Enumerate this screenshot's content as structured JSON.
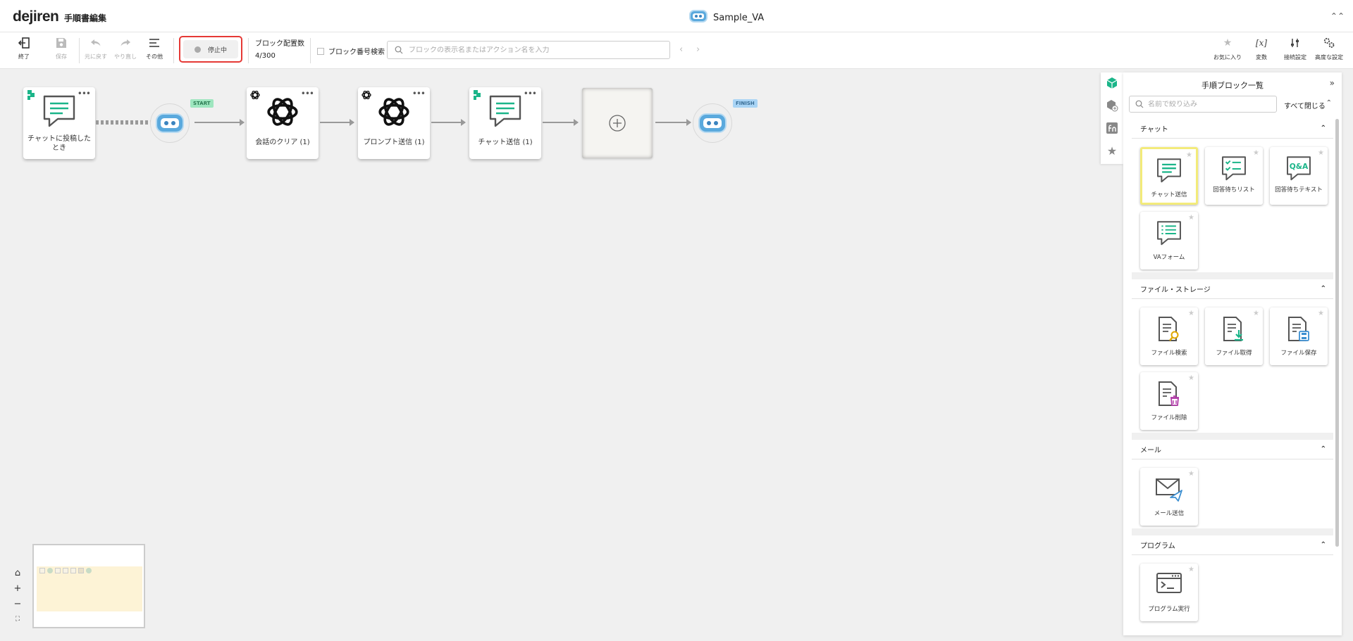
{
  "header": {
    "logo": "dejiren",
    "title": "手順書編集",
    "workflow_name": "Sample_VA"
  },
  "toolbar": {
    "exit_label": "終了",
    "save_label": "保存",
    "undo_label": "元に戻す",
    "redo_label": "やり直し",
    "other_label": "その他",
    "status_label": "停止中",
    "block_count_label": "ブロック配置数",
    "block_count_value": "4/300",
    "block_number_search_label": "ブロック番号検索",
    "search_placeholder": "ブロックの表示名またはアクション名を入力",
    "favorites_label": "お気に入り",
    "variables_label": "変数",
    "connection_label": "接続設定",
    "advanced_label": "高度な設定",
    "variables_icon_text": "[x]"
  },
  "canvas": {
    "tag_start": "START",
    "tag_finish": "FINISH",
    "blocks": [
      {
        "label": "チャットに投稿したとき"
      },
      {
        "label": "会話のクリア (1)"
      },
      {
        "label": "プロンプト送信 (1)"
      },
      {
        "label": "チャット送信 (1)"
      }
    ]
  },
  "panel": {
    "title": "手順ブロック一覧",
    "filter_placeholder": "名前で絞り込み",
    "close_all_label": "すべて閉じる",
    "categories": [
      {
        "name": "チャット",
        "items": [
          "チャット送信",
          "回答待ちリスト",
          "回答待ちテキスト",
          "VAフォーム"
        ]
      },
      {
        "name": "ファイル・ストレージ",
        "items": [
          "ファイル検索",
          "ファイル取得",
          "ファイル保存",
          "ファイル削除"
        ]
      },
      {
        "name": "メール",
        "items": [
          "メール送信"
        ]
      },
      {
        "name": "プログラム",
        "items": [
          "プログラム実行"
        ]
      }
    ]
  },
  "colors": {
    "accent_green": "#1bb589",
    "robot_blue": "#5aa9dd",
    "highlight_red": "#e53935"
  }
}
